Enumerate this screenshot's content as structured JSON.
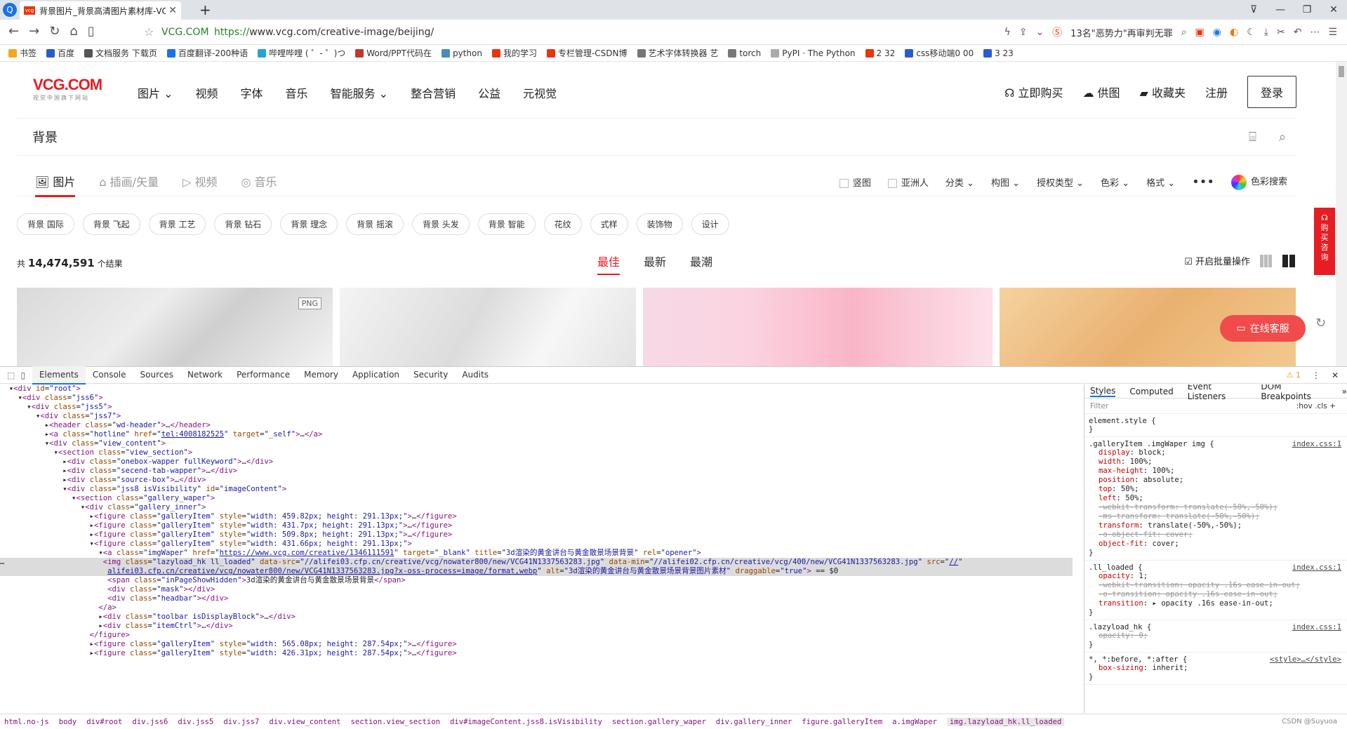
{
  "browser": {
    "tab_title": "背景图片_背景高清图片素材库-VCG",
    "tab_favicon_label": "vcg",
    "address_host": "VCG.COM",
    "url_protocol": "https://",
    "url_rest": "www.vcg.com/creative-image/beijing/",
    "news_ticker": "13名\"恶势力\"再审判无罪",
    "bookmarks": [
      "书签",
      "百度",
      "文档服务 下载页",
      "百度翻译-200种语",
      "哔哩哔哩 ( ゜- ゜)つ",
      "Word/PPT代码在",
      "python",
      "我的学习",
      "专栏管理-CSDN博",
      "艺术字体转换器 艺",
      "torch",
      "PyPI · The Python",
      "2 32",
      "css移动端0 00",
      "3 23"
    ]
  },
  "site": {
    "brand": "VCG.COM",
    "brand_sub": "视觉中国旗下网站",
    "nav": [
      "图片",
      "视频",
      "字体",
      "音乐",
      "智能服务",
      "整合营销",
      "公益",
      "元视觉"
    ],
    "top_actions": [
      "立即购买",
      "供图",
      "收藏夹",
      "注册"
    ],
    "login": "登录",
    "search_value": "背景",
    "types": [
      "图片",
      "插画/矢量",
      "视频",
      "音乐"
    ],
    "filters": {
      "vertical": "竖图",
      "asian": "亚洲人",
      "category": "分类",
      "composition": "构图",
      "license": "授权类型",
      "color": "色彩",
      "format": "格式",
      "color_search": "色彩搜索"
    },
    "tags": [
      "背景 国际",
      "背景 飞起",
      "背景 工艺",
      "背景 钻石",
      "背景 理念",
      "背景 摇滚",
      "背景 头发",
      "背景 智能",
      "花纹",
      "式样",
      "装饰物",
      "设计"
    ],
    "result_prefix": "共",
    "result_count": "14,474,591",
    "result_suffix": "个结果",
    "sort": [
      "最佳",
      "最新",
      "最潮"
    ],
    "batch": "开启批量操作",
    "png_badge": "PNG",
    "side_label": "购买咨询",
    "chat": "在线客服"
  },
  "devtools": {
    "tabs": [
      "Elements",
      "Console",
      "Sources",
      "Network",
      "Performance",
      "Memory",
      "Application",
      "Security",
      "Audits"
    ],
    "warn_count": "1",
    "style_tabs": [
      "Styles",
      "Computed",
      "Event Listeners",
      "DOM Breakpoints"
    ],
    "filter_placeholder": "Filter",
    "filter_tools": ":hov  .cls  +",
    "breadcrumb": [
      "html.no-js",
      "body",
      "div#root",
      "div.jss6",
      "div.jss5",
      "div.jss7",
      "div.view_content",
      "section.view_section",
      "div#imageContent.jss8.isVisibility",
      "section.gallery_waper",
      "div.gallery_inner",
      "figure.galleryItem",
      "a.imgWaper",
      "img.lazyload_hk.ll_loaded"
    ],
    "credit": "CSDN @Suyuoa"
  }
}
